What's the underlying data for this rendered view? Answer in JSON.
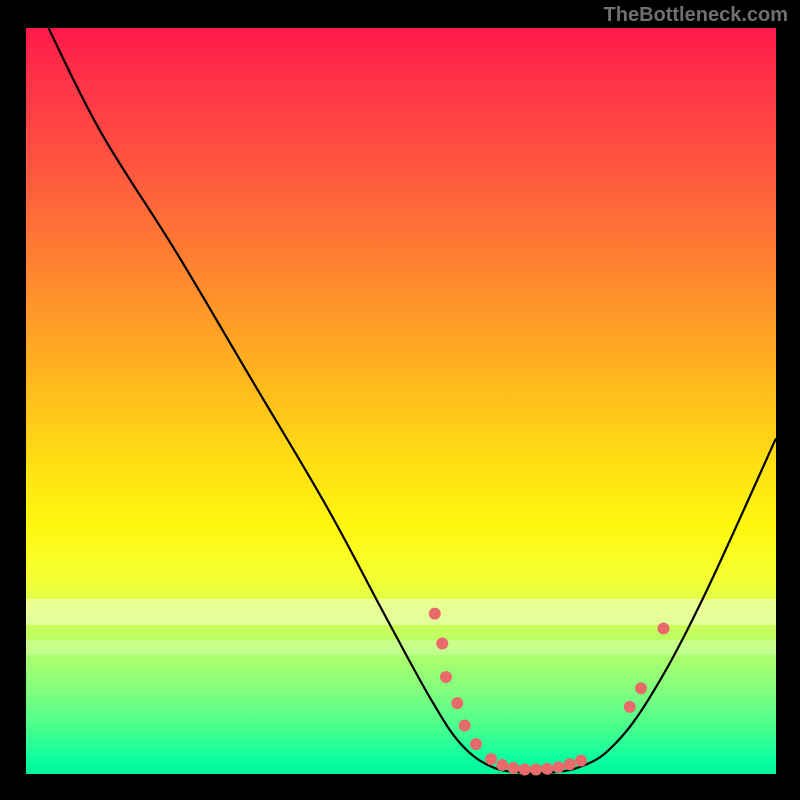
{
  "watermark": "TheBottleneck.com",
  "chart_data": {
    "type": "line",
    "title": "",
    "xlabel": "",
    "ylabel": "",
    "xlim": [
      0,
      100
    ],
    "ylim": [
      0,
      100
    ],
    "curve": [
      {
        "x": 3.0,
        "y": 100.0
      },
      {
        "x": 10.0,
        "y": 86.0
      },
      {
        "x": 20.0,
        "y": 70.0
      },
      {
        "x": 30.0,
        "y": 53.0
      },
      {
        "x": 40.0,
        "y": 36.0
      },
      {
        "x": 48.0,
        "y": 21.0
      },
      {
        "x": 54.0,
        "y": 10.0
      },
      {
        "x": 58.0,
        "y": 4.0
      },
      {
        "x": 62.0,
        "y": 1.0
      },
      {
        "x": 66.0,
        "y": 0.2
      },
      {
        "x": 70.0,
        "y": 0.2
      },
      {
        "x": 74.0,
        "y": 1.0
      },
      {
        "x": 78.0,
        "y": 3.5
      },
      {
        "x": 83.0,
        "y": 10.0
      },
      {
        "x": 90.0,
        "y": 23.0
      },
      {
        "x": 100.0,
        "y": 45.0
      }
    ],
    "points": [
      {
        "x": 54.5,
        "y": 21.5
      },
      {
        "x": 55.5,
        "y": 17.5
      },
      {
        "x": 56.0,
        "y": 13.0
      },
      {
        "x": 57.5,
        "y": 9.5
      },
      {
        "x": 58.5,
        "y": 6.5
      },
      {
        "x": 60.0,
        "y": 4.0
      },
      {
        "x": 62.0,
        "y": 2.0
      },
      {
        "x": 63.5,
        "y": 1.2
      },
      {
        "x": 65.0,
        "y": 0.8
      },
      {
        "x": 66.5,
        "y": 0.6
      },
      {
        "x": 68.0,
        "y": 0.6
      },
      {
        "x": 69.5,
        "y": 0.7
      },
      {
        "x": 71.0,
        "y": 0.9
      },
      {
        "x": 72.5,
        "y": 1.3
      },
      {
        "x": 74.0,
        "y": 1.8
      },
      {
        "x": 80.5,
        "y": 9.0
      },
      {
        "x": 82.0,
        "y": 11.5
      },
      {
        "x": 85.0,
        "y": 19.5
      }
    ],
    "point_color": "#e86a6a",
    "point_radius_px": 6
  }
}
